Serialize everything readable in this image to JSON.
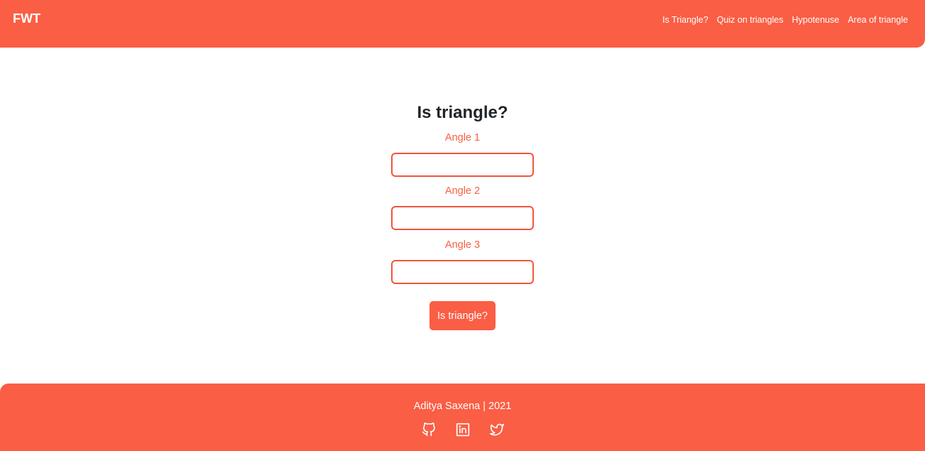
{
  "navbar": {
    "brand": "FWT",
    "links": [
      {
        "label": "Is Triangle?"
      },
      {
        "label": "Quiz on triangles"
      },
      {
        "label": "Hypotenuse"
      },
      {
        "label": "Area of triangle"
      }
    ]
  },
  "main": {
    "title": "Is triangle?",
    "fields": [
      {
        "label": "Angle 1",
        "value": ""
      },
      {
        "label": "Angle 2",
        "value": ""
      },
      {
        "label": "Angle 3",
        "value": ""
      }
    ],
    "button_label": "Is triangle?"
  },
  "footer": {
    "credit": "Aditya Saxena | 2021",
    "social": [
      {
        "icon": "github-icon"
      },
      {
        "icon": "linkedin-icon"
      },
      {
        "icon": "twitter-icon"
      }
    ]
  },
  "colors": {
    "accent": "#fa5e44",
    "text_dark": "#212529",
    "background": "#ffffff"
  }
}
